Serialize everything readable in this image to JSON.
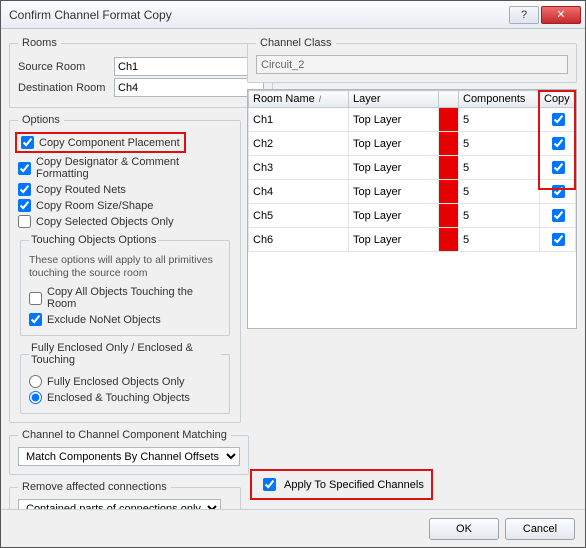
{
  "window": {
    "title": "Confirm Channel Format Copy"
  },
  "rooms": {
    "legend": "Rooms",
    "source_label": "Source Room",
    "source_value": "Ch1",
    "dest_label": "Destination Room",
    "dest_value": "Ch4"
  },
  "options": {
    "legend": "Options",
    "copy_component_placement": "Copy Component Placement",
    "copy_designator": "Copy Designator & Comment Formatting",
    "copy_routed_nets": "Copy Routed Nets",
    "copy_room_size": "Copy Room Size/Shape",
    "copy_selected_only": "Copy Selected Objects Only",
    "touching": {
      "legend": "Touching Objects Options",
      "desc": "These options will apply to all primitives touching the source room",
      "copy_all_touching": "Copy All Objects Touching the Room",
      "exclude_nonet": "Exclude NoNet Objects"
    },
    "enclosed": {
      "legend": "Fully Enclosed Only / Enclosed & Touching",
      "fully": "Fully Enclosed Objects Only",
      "touching": "Enclosed & Touching Objects"
    }
  },
  "matching": {
    "legend": "Channel to Channel Component Matching",
    "value": "Match Components By Channel Offsets"
  },
  "remove": {
    "legend": "Remove affected connections",
    "value": "Contained parts of connections only"
  },
  "channel_class": {
    "legend": "Channel Class",
    "value": "Circuit_2"
  },
  "table": {
    "headers": {
      "room": "Room Name",
      "layer": "Layer",
      "components": "Components",
      "copy": "Copy"
    },
    "rows": [
      {
        "room": "Ch1",
        "layer": "Top Layer",
        "components": "5",
        "copy": true
      },
      {
        "room": "Ch2",
        "layer": "Top Layer",
        "components": "5",
        "copy": true
      },
      {
        "room": "Ch3",
        "layer": "Top Layer",
        "components": "5",
        "copy": true
      },
      {
        "room": "Ch4",
        "layer": "Top Layer",
        "components": "5",
        "copy": true
      },
      {
        "room": "Ch5",
        "layer": "Top Layer",
        "components": "5",
        "copy": true
      },
      {
        "room": "Ch6",
        "layer": "Top Layer",
        "components": "5",
        "copy": true
      }
    ]
  },
  "apply": {
    "label": "Apply To Specified Channels",
    "checked": true
  },
  "footer": {
    "ok": "OK",
    "cancel": "Cancel"
  },
  "icons": {
    "help": "?",
    "close": "✕",
    "sort": "/"
  }
}
